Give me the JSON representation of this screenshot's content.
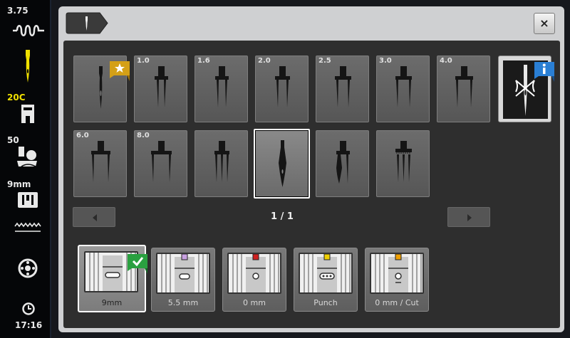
{
  "sidebar": {
    "stitch_width": "3.75",
    "needle_position": "20C",
    "foot_pressure": "50",
    "stitch_plate": "9mm",
    "time": "17:16"
  },
  "dialog": {
    "close_label": "×",
    "page_indicator": "1 / 1"
  },
  "needles": [
    {
      "label": "",
      "type": "single",
      "favorite": true
    },
    {
      "label": "1.0",
      "type": "double"
    },
    {
      "label": "1.6",
      "type": "double"
    },
    {
      "label": "2.0",
      "type": "double"
    },
    {
      "label": "2.5",
      "type": "double"
    },
    {
      "label": "3.0",
      "type": "double"
    },
    {
      "label": "4.0",
      "type": "double"
    },
    {
      "label": "6.0",
      "type": "double"
    },
    {
      "label": "8.0",
      "type": "double"
    },
    {
      "label": "",
      "type": "triple"
    },
    {
      "label": "",
      "type": "wing",
      "selected": true
    },
    {
      "label": "",
      "type": "double-wing"
    },
    {
      "label": "",
      "type": "triple-bar"
    }
  ],
  "feet": [
    {
      "label": "9mm",
      "selected": true,
      "dot_color": ""
    },
    {
      "label": "5.5 mm",
      "dot_color": "#c8a0e0"
    },
    {
      "label": "0 mm",
      "dot_color": "#d02020"
    },
    {
      "label": "Punch",
      "dot_color": "#f0d000"
    },
    {
      "label": "0 mm / Cut",
      "dot_color": "#f0a000"
    }
  ],
  "colors": {
    "accent_yellow": "#f0e000",
    "badge_gold": "#d4a017",
    "badge_blue": "#2a7fd4",
    "badge_green": "#2aa040"
  }
}
